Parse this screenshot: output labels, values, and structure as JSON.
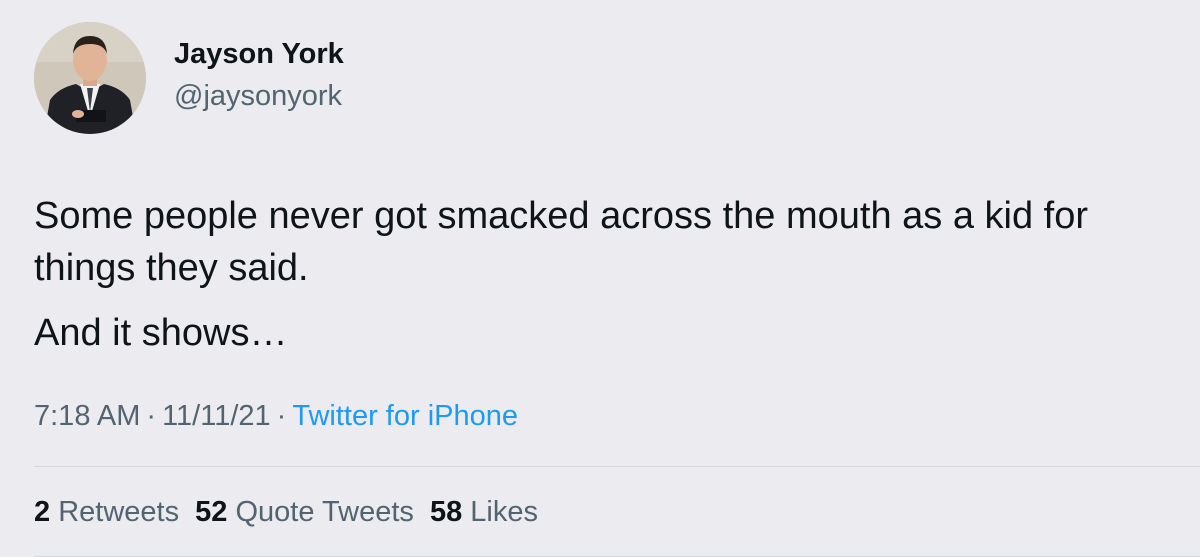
{
  "author": {
    "display_name": "Jayson York",
    "handle": "@jaysonyork"
  },
  "tweet": {
    "paragraphs": [
      "Some people never got smacked across the mouth as a kid for things they said.",
      "And it shows…"
    ],
    "time": "7:18 AM",
    "date": "11/11/21",
    "separator": "·",
    "source": "Twitter for iPhone"
  },
  "stats": {
    "retweets_count": "2",
    "retweets_label": "Retweets",
    "quote_tweets_count": "52",
    "quote_tweets_label": "Quote Tweets",
    "likes_count": "58",
    "likes_label": "Likes"
  },
  "colors": {
    "background": "#ebebf0",
    "text_primary": "#0f1419",
    "text_secondary": "#536471",
    "link": "#1d9bf0",
    "divider": "#d4d7db"
  }
}
